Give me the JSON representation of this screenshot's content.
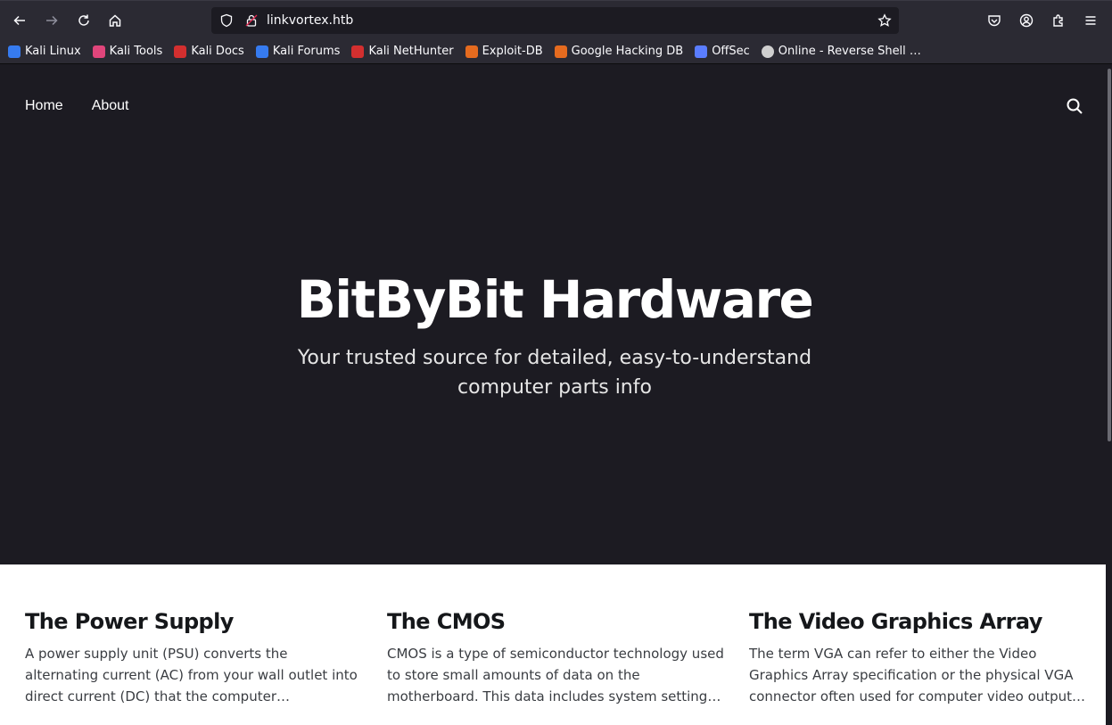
{
  "browser": {
    "url": "linkvortex.htb",
    "bookmarks": [
      {
        "label": "Kali Linux",
        "icon": "kali-dragon-icon",
        "color": "#367bf0"
      },
      {
        "label": "Kali Tools",
        "icon": "kali-tools-icon",
        "color": "#e0457b"
      },
      {
        "label": "Kali Docs",
        "icon": "kali-docs-icon",
        "color": "#d32f2f"
      },
      {
        "label": "Kali Forums",
        "icon": "kali-forums-icon",
        "color": "#367bf0"
      },
      {
        "label": "Kali NetHunter",
        "icon": "kali-nethunter-icon",
        "color": "#d32f2f"
      },
      {
        "label": "Exploit-DB",
        "icon": "exploit-db-icon",
        "color": "#e56b1f"
      },
      {
        "label": "Google Hacking DB",
        "icon": "ghdb-icon",
        "color": "#e56b1f"
      },
      {
        "label": "OffSec",
        "icon": "offsec-icon",
        "color": "#5a7dff"
      },
      {
        "label": "Online - Reverse Shell …",
        "icon": "skull-icon",
        "color": "#cfcfcf"
      }
    ]
  },
  "site": {
    "nav": [
      "Home",
      "About"
    ],
    "title": "BitByBit Hardware",
    "subtitle": "Your trusted source for detailed, easy-to-understand computer parts info"
  },
  "posts": [
    {
      "title": "The Power Supply",
      "excerpt": "A power supply unit (PSU) converts the alternating current (AC) from your wall outlet into direct current (DC) that the computer components require. It…"
    },
    {
      "title": "The CMOS",
      "excerpt": "CMOS is a type of semiconductor technology used to store small amounts of data on the motherboard. This data includes system settings and configurati…"
    },
    {
      "title": "The Video Graphics Array",
      "excerpt": "The term VGA can refer to either the Video Graphics Array specification or the physical VGA connector often used for computer video output. Below, I'll…"
    }
  ],
  "colors": {
    "hero_bg": "#1c1b22",
    "toolbar_bg": "#2b2a33",
    "posts_bg": "#ffffff"
  }
}
